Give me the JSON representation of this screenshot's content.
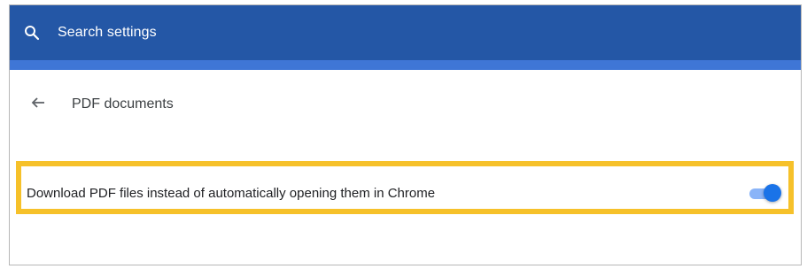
{
  "search": {
    "placeholder": "Search settings",
    "icon": "search-icon"
  },
  "subpage": {
    "back_icon": "arrow-left-icon",
    "title": "PDF documents"
  },
  "setting": {
    "label": "Download PDF files instead of automatically opening them in Chrome",
    "enabled": true
  },
  "colors": {
    "header_bg": "#2457a6",
    "header_strip": "#3f76d6",
    "highlight_border": "#f6c12a",
    "toggle_knob": "#1a73e8",
    "toggle_track": "#8ab4f8"
  }
}
